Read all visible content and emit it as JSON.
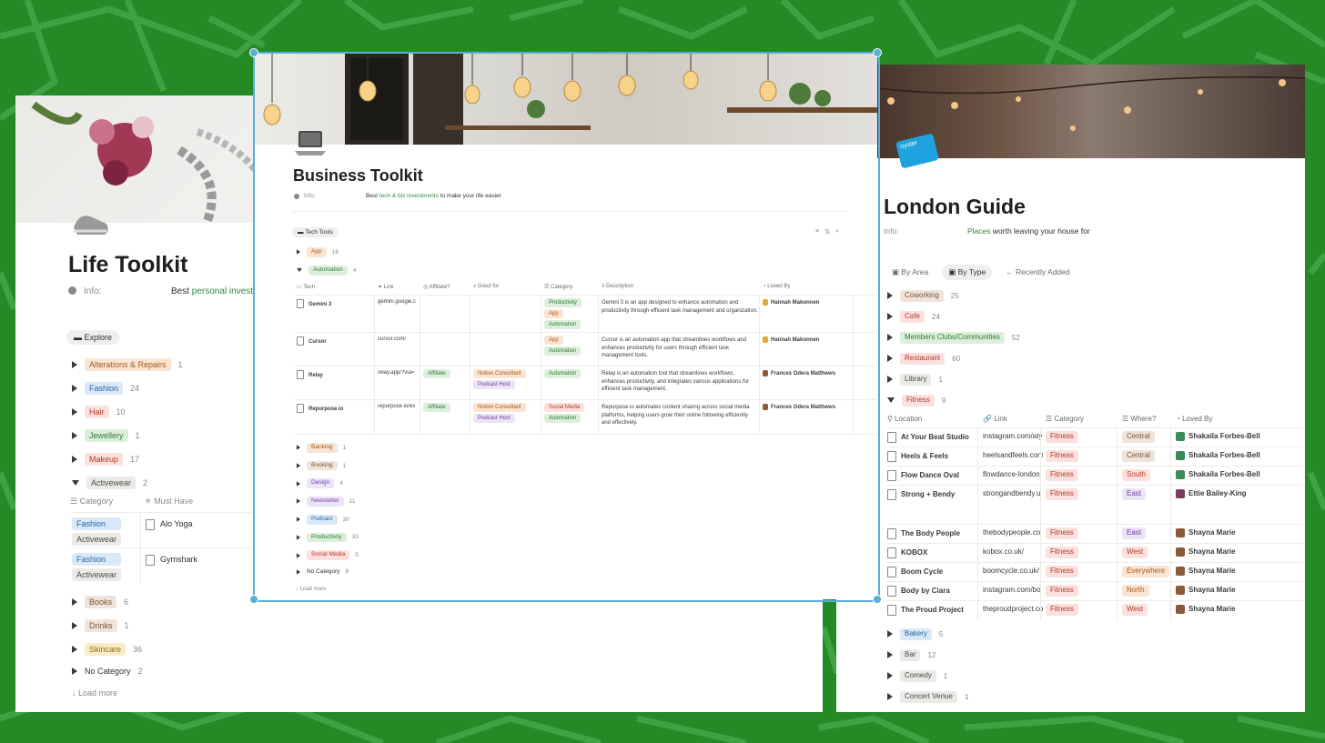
{
  "colors": {
    "background": "#238a26",
    "map_lines": "#4aaa4b",
    "selection": "#5aaed6",
    "link_green": "#2f8a3c"
  },
  "left": {
    "title": "Life Toolkit",
    "info_label": "Info:",
    "info_prefix": "Best",
    "info_link": "personal investme",
    "explore_tab": "Explore",
    "groups": [
      {
        "label": "Alterations & Repairs",
        "count": "1",
        "color": "orange"
      },
      {
        "label": "Fashion",
        "count": "24",
        "color": "blue"
      },
      {
        "label": "Hair",
        "count": "10",
        "color": "red"
      },
      {
        "label": "Jewellery",
        "count": "1",
        "color": "green"
      },
      {
        "label": "Makeup",
        "count": "17",
        "color": "red"
      },
      {
        "label": "Activewear",
        "count": "2",
        "color": "grey"
      }
    ],
    "columns": [
      "Category",
      "Must Have"
    ],
    "rows": [
      {
        "tags": [
          "Fashion",
          "Activewear"
        ],
        "name": "Alo Yoga"
      },
      {
        "tags": [
          "Fashion",
          "Activewear"
        ],
        "name": "Gymshark"
      }
    ],
    "groups_after": [
      {
        "label": "Books",
        "count": "6",
        "color": "brown"
      },
      {
        "label": "Drinks",
        "count": "1",
        "color": "brown"
      },
      {
        "label": "Skincare",
        "count": "36",
        "color": "yellow"
      },
      {
        "label": "No Category",
        "count": "2",
        "color": "none"
      }
    ],
    "load_more": "Load more"
  },
  "center": {
    "title": "Business Toolkit",
    "info_label": "Info:",
    "info_prefix": "Best",
    "info_link": "tech & biz investments",
    "info_suffix": "to make your life easier",
    "view_tab": "Tech Tools",
    "groups_top": [
      {
        "label": "App",
        "count": "16",
        "color": "orange"
      },
      {
        "label": "Automation",
        "count": "4",
        "color": "green"
      }
    ],
    "columns": [
      "Tech",
      "Link",
      "Affiliate?",
      "Good for",
      "Category",
      "Description",
      "Loved By"
    ],
    "rows": [
      {
        "tech": "Gemini 3",
        "link": "gemini.google.c",
        "affiliate": "",
        "good_for": [],
        "category": [
          "Productivity",
          "App",
          "Automation"
        ],
        "description": "Gemini 3 is an app designed to enhance automation and productivity through efficient task management and organization.",
        "loved_by": "Hannah Makonnen"
      },
      {
        "tech": "Cursor",
        "link": "cursor.com/",
        "affiliate": "",
        "good_for": [],
        "category": [
          "App",
          "Automation"
        ],
        "description": "Cursor is an automation app that streamlines workflows and enhances productivity for users through efficient task management tools.",
        "loved_by": "Hannah Makonnen"
      },
      {
        "tech": "Relay",
        "link": "relay.app/?via=",
        "affiliate": "Affiliate",
        "good_for": [
          "Notion Consultant",
          "Podcast Host"
        ],
        "category": [
          "Automation"
        ],
        "description": "Relay is an automation tool that streamlines workflows, enhances productivity, and integrates various applications for efficient task management.",
        "loved_by": "Frances Odera Matthews"
      },
      {
        "tech": "Repurpose.io",
        "link": "repurpose.io/ex",
        "affiliate": "Affiliate",
        "good_for": [
          "Notion Consultant",
          "Podcast Host"
        ],
        "category": [
          "Social Media",
          "Automation"
        ],
        "description": "Repurpose.io automates content sharing across social media platforms, helping users grow their online following efficiently and effectively.",
        "loved_by": "Frances Odera Matthews"
      }
    ],
    "groups_bottom": [
      {
        "label": "Banking",
        "count": "1",
        "color": "orange"
      },
      {
        "label": "Booking",
        "count": "1",
        "color": "brown"
      },
      {
        "label": "Design",
        "count": "4",
        "color": "purple"
      },
      {
        "label": "Newsletter",
        "count": "11",
        "color": "purple"
      },
      {
        "label": "Podcast",
        "count": "30",
        "color": "blue"
      },
      {
        "label": "Productivity",
        "count": "33",
        "color": "green"
      },
      {
        "label": "Social Media",
        "count": "5",
        "color": "red"
      },
      {
        "label": "No Category",
        "count": "8",
        "color": "none"
      }
    ],
    "load_more": "Load more"
  },
  "right": {
    "title": "London Guide",
    "cover_badge": "oyster",
    "info_label": "Info:",
    "info_link": "Places",
    "info_suffix": "worth leaving your house for",
    "tabs": [
      "By Area",
      "By Type",
      "Recently Added"
    ],
    "groups_top": [
      {
        "label": "Coworking",
        "count": "25",
        "color": "brown"
      },
      {
        "label": "Cafe",
        "count": "24",
        "color": "red"
      },
      {
        "label": "Members Clubs/Communities",
        "count": "52",
        "color": "green"
      },
      {
        "label": "Restaurant",
        "count": "60",
        "color": "red"
      },
      {
        "label": "Library",
        "count": "1",
        "color": "grey"
      },
      {
        "label": "Fitness",
        "count": "9",
        "color": "red"
      }
    ],
    "columns": [
      "Location",
      "Link",
      "Category",
      "Where?",
      "Loved By"
    ],
    "rows": [
      {
        "name": "At Your Beat Studio",
        "link": "instagram.com/aty",
        "category": "Fitness",
        "where": "Central",
        "where_color": "brown",
        "loved_by": "Shakaila Forbes-Bell",
        "av": "#3d8a5a"
      },
      {
        "name": "Heels & Feels",
        "link": "heelsandfeels.com",
        "category": "Fitness",
        "where": "Central",
        "where_color": "brown",
        "loved_by": "Shakaila Forbes-Bell",
        "av": "#3d8a5a"
      },
      {
        "name": "Flow Dance Oval",
        "link": "flowdance-london",
        "category": "Fitness",
        "where": "South",
        "where_color": "red",
        "loved_by": "Shakaila Forbes-Bell",
        "av": "#3d8a5a"
      },
      {
        "name": "Strong + Bendy",
        "link": "strongandbendy.u",
        "category": "Fitness",
        "where": "East",
        "where_color": "purple",
        "loved_by": "Ettie Bailey-King",
        "av": "#7a3d5a"
      },
      {
        "name": "The Body People",
        "link": "thebodypeople.co",
        "category": "Fitness",
        "where": "East",
        "where_color": "purple",
        "loved_by": "Shayna Marie",
        "av": "#8a5a3a"
      },
      {
        "name": "KOBOX",
        "link": "kobox.co.uk/",
        "category": "Fitness",
        "where": "West",
        "where_color": "red",
        "loved_by": "Shayna Marie",
        "av": "#8a5a3a"
      },
      {
        "name": "Boom Cycle",
        "link": "boomcycle.co.uk/",
        "category": "Fitness",
        "where": "Everywhere",
        "where_color": "orange",
        "loved_by": "Shayna Marie",
        "av": "#8a5a3a"
      },
      {
        "name": "Body by Ciara",
        "link": "instagram.com/bo",
        "category": "Fitness",
        "where": "North",
        "where_color": "orange",
        "loved_by": "Shayna Marie",
        "av": "#8a5a3a"
      },
      {
        "name": "The Proud Project",
        "link": "theproudproject.co",
        "category": "Fitness",
        "where": "West",
        "where_color": "red",
        "loved_by": "Shayna Marie",
        "av": "#8a5a3a"
      }
    ],
    "groups_bottom": [
      {
        "label": "Bakery",
        "count": "5",
        "color": "blue"
      },
      {
        "label": "Bar",
        "count": "12",
        "color": "grey"
      },
      {
        "label": "Comedy",
        "count": "1",
        "color": "grey"
      },
      {
        "label": "Concert Venue",
        "count": "1",
        "color": "grey"
      }
    ]
  }
}
